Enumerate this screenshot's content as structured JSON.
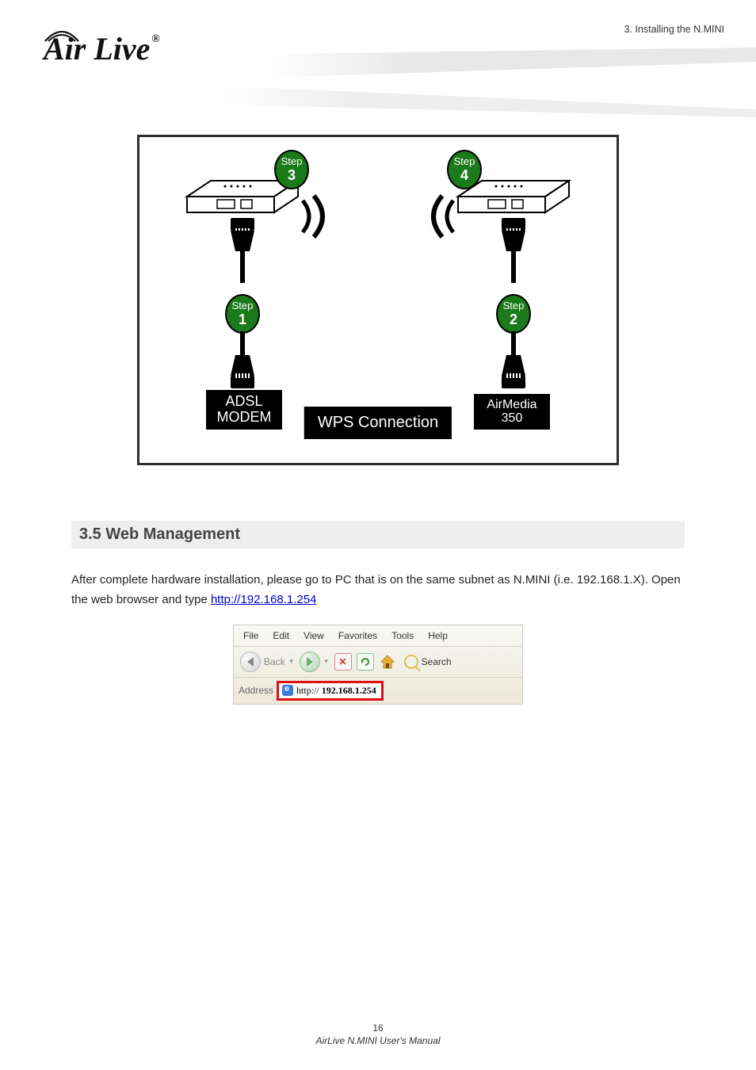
{
  "header": {
    "brand": "Air Live",
    "chapter_ref": "3. Installing the N.MINI"
  },
  "diagram": {
    "step_label": "Step",
    "step1_num": "1",
    "step2_num": "2",
    "step3_num": "3",
    "step4_num": "4",
    "adsl_label": "ADSL\nMODEM",
    "airmedia_label": "AirMedia\n350",
    "wps_label": "WPS Connection"
  },
  "section": {
    "heading": "3.5 Web Management",
    "para": "After complete hardware installation, please go to PC that is on the same subnet as N.MINI (i.e. 192.168.1.X). Open the web browser and type ",
    "url": "http://192.168.1.254",
    "url_text": "http://192.168.1.254"
  },
  "browser": {
    "menu": {
      "file": "File",
      "edit": "Edit",
      "view": "View",
      "favorites": "Favorites",
      "tools": "Tools",
      "help": "Help"
    },
    "back": "Back",
    "search": "Search",
    "address_label": "Address",
    "address_prefix": "http:// ",
    "address_host": "192.168.1.254"
  },
  "footer": {
    "page": "16",
    "product_left": "AirLive N.MINI",
    "product_right": " User's Manual"
  }
}
